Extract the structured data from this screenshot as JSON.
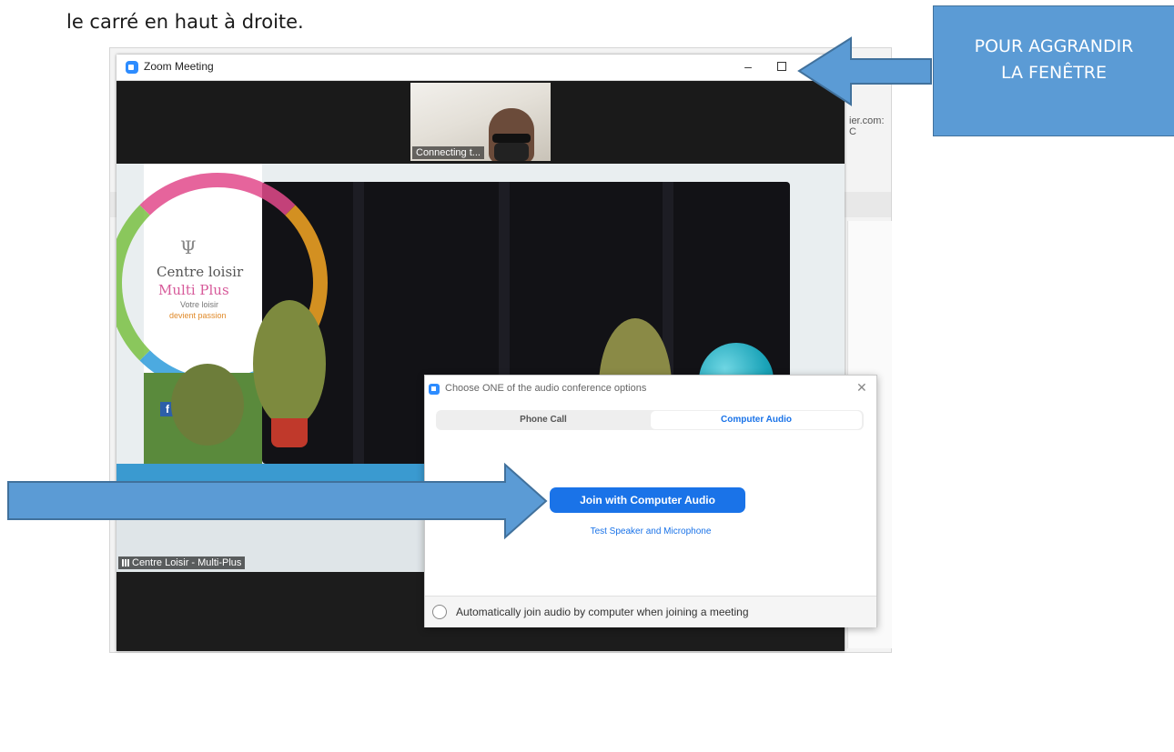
{
  "document": {
    "instruction_text": "le carré en haut à droite."
  },
  "background_window": {
    "partial_text": "ier.com: C"
  },
  "zoom_window": {
    "title": "Zoom Meeting",
    "minimize_glyph": "–",
    "close_glyph": "✕",
    "thumbnail_label": "Connecting t...",
    "speaker_name": "Centre Loisir - Multi-Plus",
    "banner": {
      "logo_glyph": "Ψ",
      "line1": "Centre loisir",
      "line2": "Multi Plus",
      "line3": "Votre loisir",
      "line4": "devient passion",
      "social_glyph": "f"
    }
  },
  "audio_dialog": {
    "title": "Choose ONE of the audio conference options",
    "close_glyph": "✕",
    "tabs": [
      {
        "label": "Phone Call",
        "selected": false
      },
      {
        "label": "Computer Audio",
        "selected": true
      }
    ],
    "primary_button": "Join with Computer Audio",
    "test_link": "Test Speaker and Microphone",
    "auto_join_label": "Automatically join audio by computer when joining a meeting",
    "auto_join_checked": false
  },
  "annotations": {
    "callout_line1": "POUR AGGRANDIR",
    "callout_line2": "LA FENÊTRE",
    "arrow_color": "#5b9bd5",
    "arrow_border": "#41719c"
  }
}
